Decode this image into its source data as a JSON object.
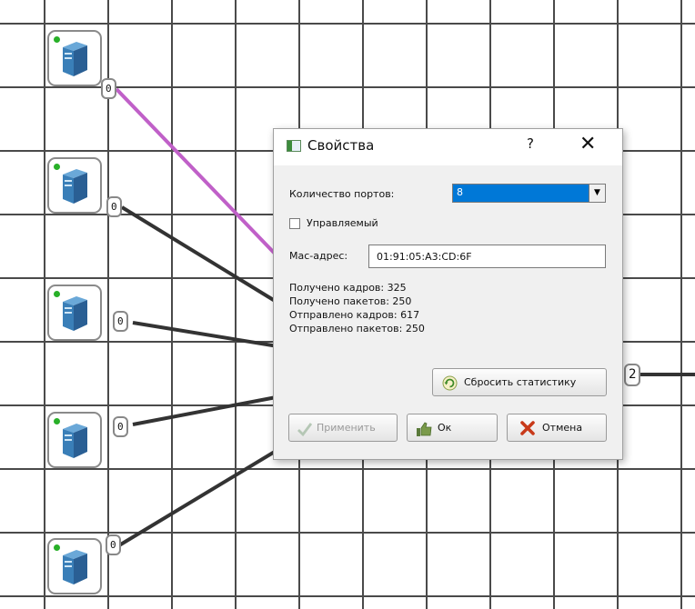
{
  "dialog": {
    "title": "Свойства",
    "help": "?",
    "close": "✕",
    "ports_label": "Количество портов:",
    "ports_value": "8",
    "managed_label": "Управляемый",
    "managed_checked": false,
    "mac_label": "Mac-адрес:",
    "mac_value": "01:91:05:A3:CD:6F",
    "stats": [
      "Получено кадров: 325",
      "Получено пакетов: 250",
      "Отправлено кадров: 617",
      "Отправлено пакетов: 250"
    ],
    "reset_button": "Сбросить статистику",
    "apply_button": "Применить",
    "ok_button": "Ок",
    "cancel_button": "Отмена"
  },
  "canvas": {
    "nodes": [
      {
        "port": "0"
      },
      {
        "port": "0"
      },
      {
        "port": "0"
      },
      {
        "port": "0"
      },
      {
        "port": "0"
      }
    ],
    "switch_port": "2"
  },
  "colors": {
    "accent": "#0078d7",
    "link": "#333333",
    "selected_link": "#c060c8",
    "status_led": "#28b028"
  },
  "icons": [
    "computer-tower-icon",
    "window-icon",
    "refresh-icon",
    "checkmark-icon",
    "thumb-up-icon",
    "cross-icon",
    "close-icon",
    "chevron-down-icon"
  ]
}
